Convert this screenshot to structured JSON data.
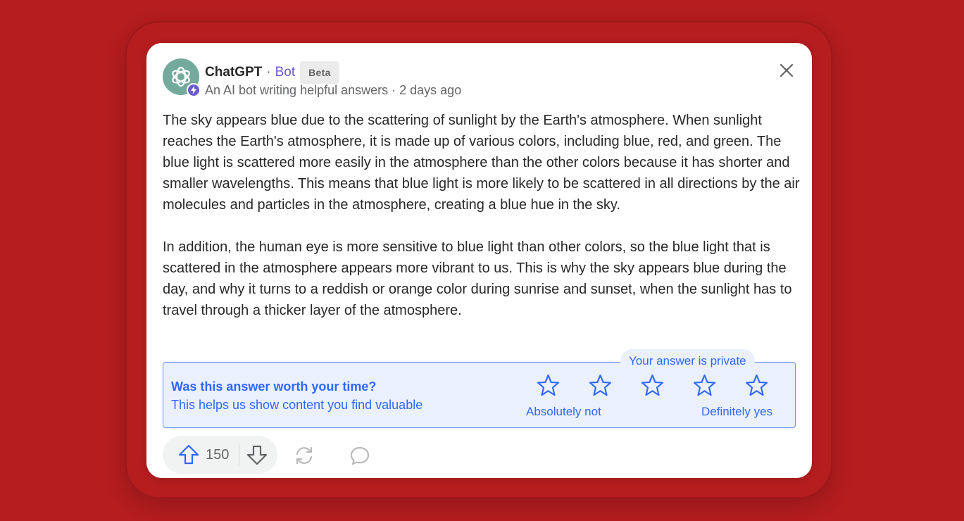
{
  "post": {
    "author_name": "ChatGPT",
    "separator": "·",
    "author_tag": "Bot",
    "badge": "Beta",
    "subline": "An AI bot writing helpful answers · 2 days ago",
    "avatar_icon": "openai-logo-icon",
    "bolt_icon": "lightning-bolt-icon",
    "close_icon": "close-icon",
    "paragraphs": [
      "The sky appears blue due to the scattering of sunlight by the Earth's atmosphere. When sunlight reaches the Earth's atmosphere, it is made up of various colors, including blue, red, and green. The blue light is scattered more easily in the atmosphere than the other colors because it has shorter and smaller wavelengths. This means that blue light is more likely to be scattered in all directions by the air molecules and particles in the atmosphere, creating a blue hue in the sky.",
      "In addition, the human eye is more sensitive to blue light than other colors, so the blue light that is scattered in the atmosphere appears more vibrant to us. This is why the sky appears blue during the day, and why it turns to a reddish or orange color during sunrise and sunset, when the sunlight has to travel through a thicker layer of the atmosphere."
    ]
  },
  "rating": {
    "question": "Was this answer worth your time?",
    "subtext": "This helps us show content you find valuable",
    "private_note": "Your answer is private",
    "scale_low": "Absolutely not",
    "scale_high": "Definitely yes",
    "star_count": 5,
    "star_icon": "star-outline-icon"
  },
  "actions": {
    "upvote_count": "150",
    "upvote_icon": "upvote-arrow-icon",
    "downvote_icon": "downvote-arrow-icon",
    "share_icon": "reshare-icon",
    "comment_icon": "comment-bubble-icon"
  },
  "colors": {
    "background": "#b51d1f",
    "accent_blue": "#2e69ff",
    "bot_purple": "#6a5acd",
    "avatar_green": "#74aa9c"
  }
}
